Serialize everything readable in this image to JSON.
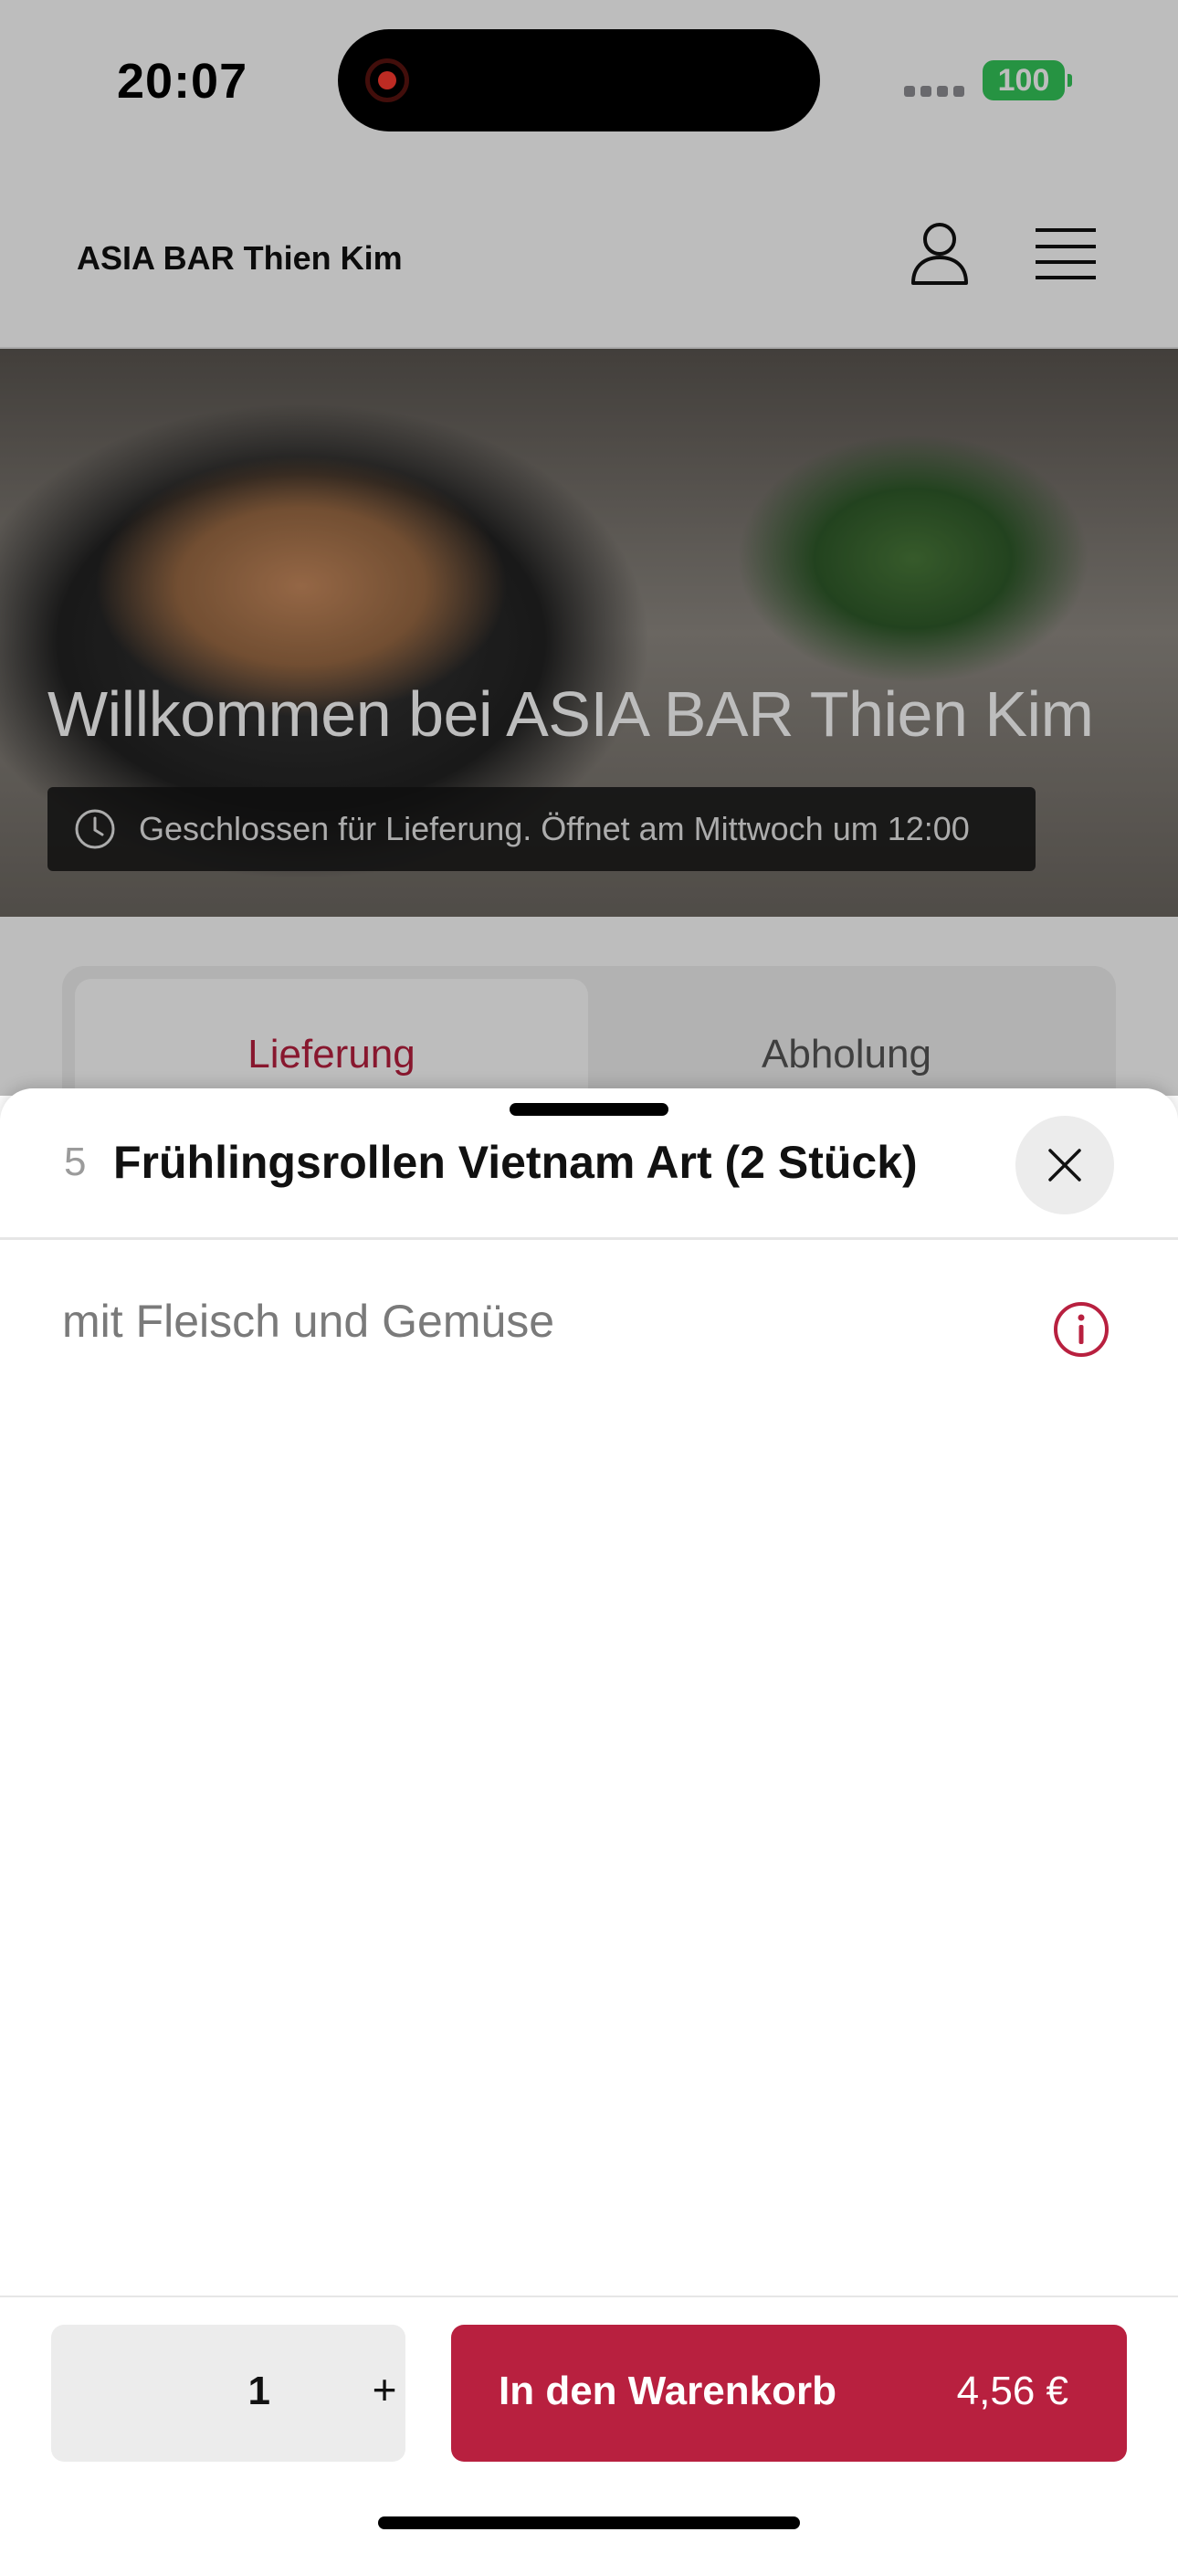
{
  "status_bar": {
    "time": "20:07",
    "battery": "100"
  },
  "header": {
    "brand": "ASIA BAR Thien Kim"
  },
  "hero": {
    "title": "Willkommen bei ASIA BAR Thien Kim",
    "status_text": "Geschlossen für Lieferung. Öffnet am Mittwoch um 12:00"
  },
  "tabs": [
    {
      "label": "Lieferung",
      "active": true
    },
    {
      "label": "Abholung",
      "active": false
    }
  ],
  "sheet": {
    "item_number": "5",
    "item_title": "Frühlingsrollen Vietnam Art (2 Stück)",
    "description": "mit Fleisch und Gemüse",
    "quantity": "1",
    "plus_label": "+",
    "add_to_cart_label": "In den Warenkorb",
    "price": "4,56 €"
  },
  "colors": {
    "accent": "#b8203f",
    "battery": "#34c759"
  },
  "icons": [
    "record-icon",
    "user-icon",
    "menu-icon",
    "clock-icon",
    "close-icon",
    "info-icon"
  ]
}
